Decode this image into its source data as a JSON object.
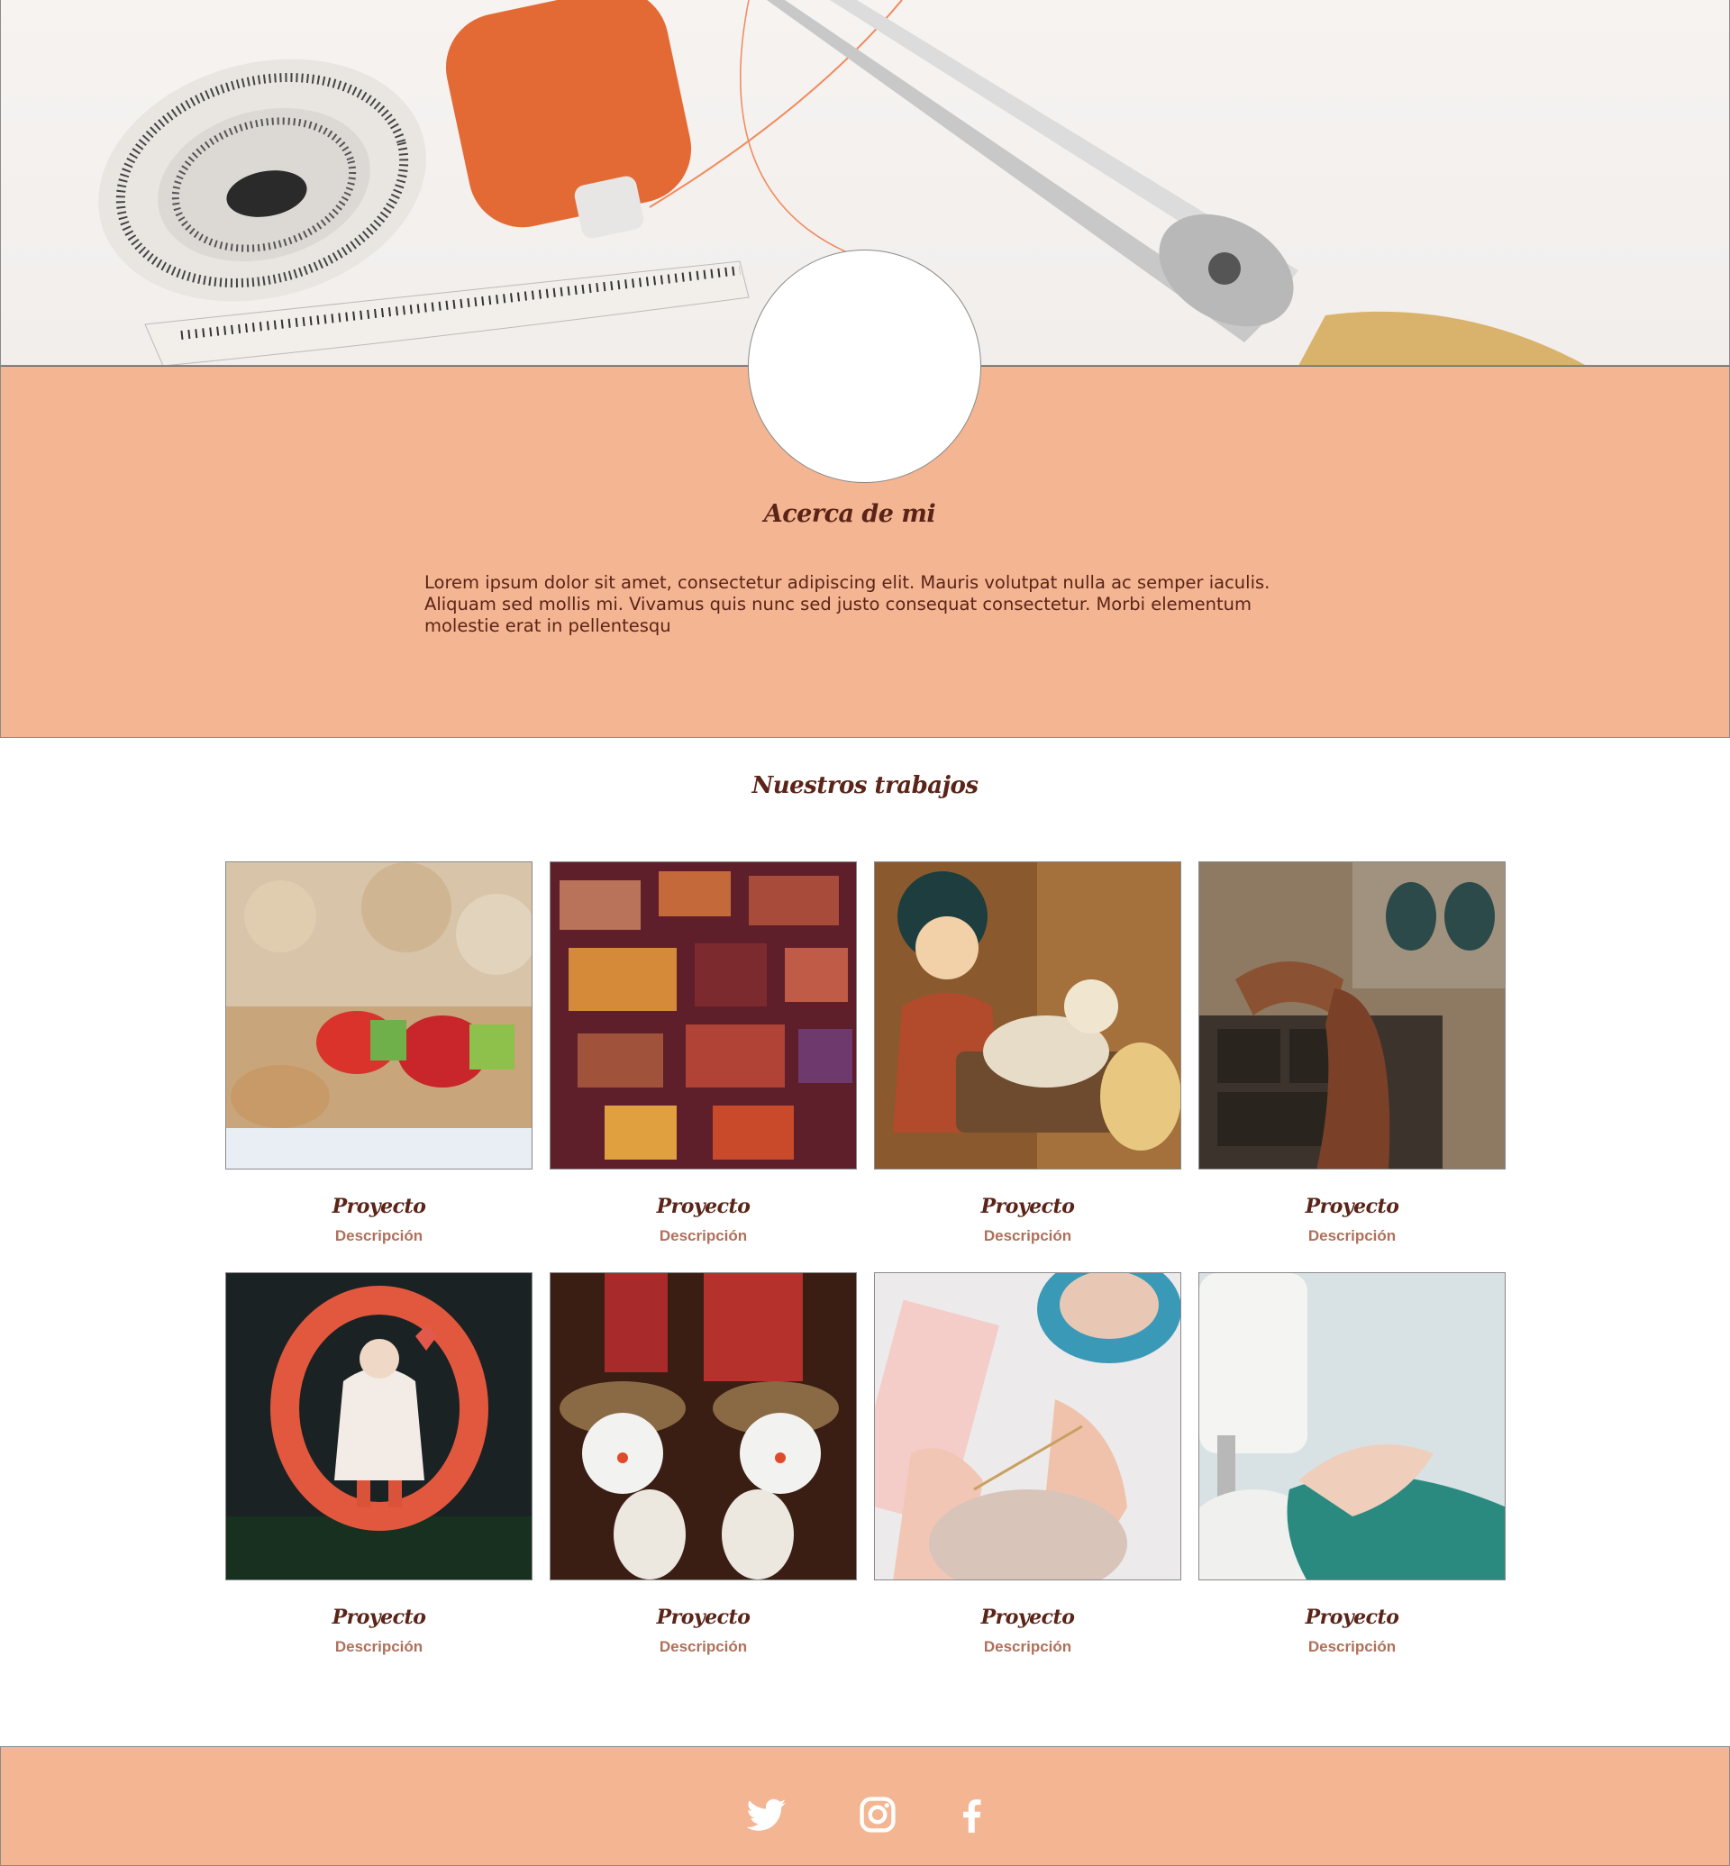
{
  "about": {
    "title": "Acerca de mi",
    "text": "Lorem ipsum dolor sit amet, consectetur adipiscing elit. Mauris volutpat nulla ac semper iaculis. Aliquam sed mollis mi. Vivamus quis nunc sed justo consequat consectetur. Morbi elementum molestie erat in pellentesqu"
  },
  "works": {
    "title": "Nuestros trabajos",
    "projects": [
      {
        "title": "Proyecto",
        "description": "Descripción"
      },
      {
        "title": "Proyecto",
        "description": "Descripción"
      },
      {
        "title": "Proyecto",
        "description": "Descripción"
      },
      {
        "title": "Proyecto",
        "description": "Descripción"
      },
      {
        "title": "Proyecto",
        "description": "Descripción"
      },
      {
        "title": "Proyecto",
        "description": "Descripción"
      },
      {
        "title": "Proyecto",
        "description": "Descripción"
      },
      {
        "title": "Proyecto",
        "description": "Descripción"
      }
    ]
  },
  "footer": {
    "social_icons": [
      "twitter-icon",
      "instagram-icon",
      "facebook-icon"
    ]
  },
  "colors": {
    "accent": "#f4b592",
    "heading": "#5a2418",
    "description": "#b0705a"
  }
}
